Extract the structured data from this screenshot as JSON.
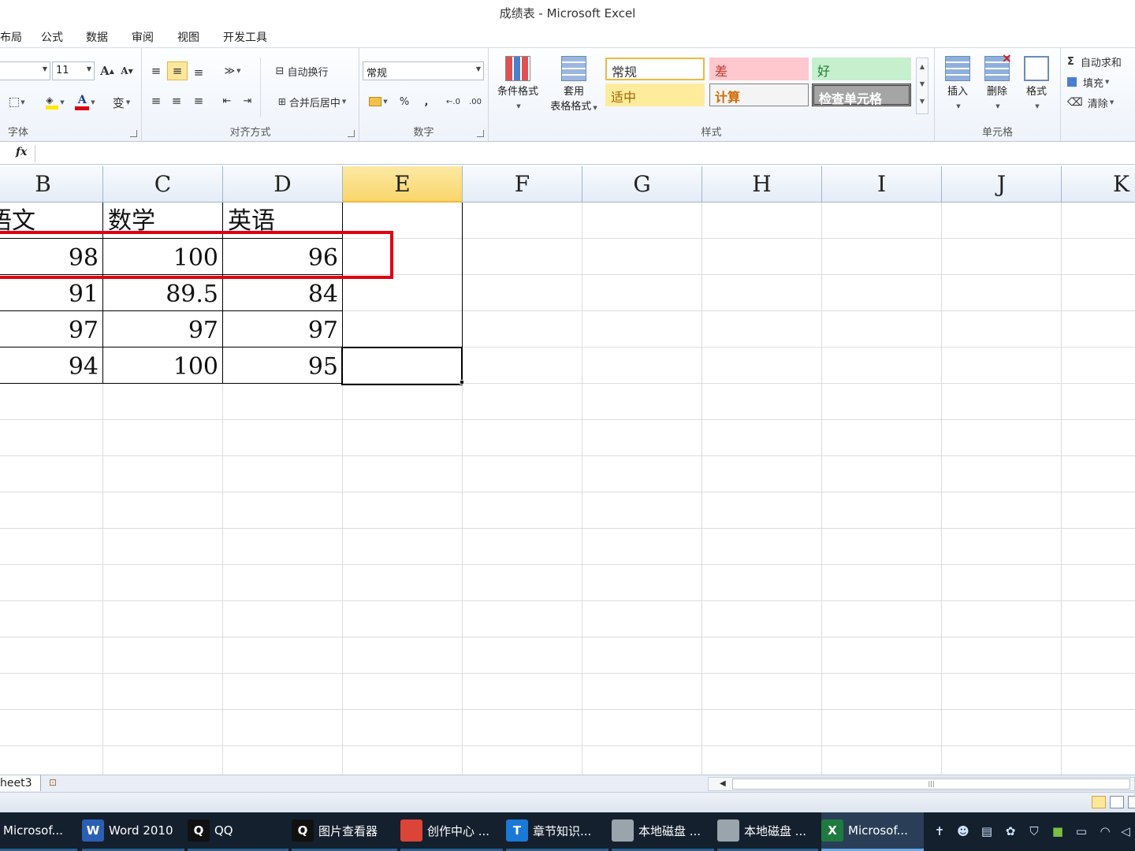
{
  "window": {
    "title": "成绩表 - Microsoft Excel"
  },
  "menu": [
    "布局",
    "公式",
    "数据",
    "审阅",
    "视图",
    "开发工具"
  ],
  "ribbon": {
    "font": {
      "size": "11",
      "label": "字体",
      "grow": "A",
      "shrink": "A",
      "font_color_letter": "A",
      "phonetic": "变"
    },
    "alignment": {
      "label": "对齐方式",
      "wrap_text": "自动换行",
      "merge_center": "合并后居中"
    },
    "number": {
      "label": "数字",
      "format": "常规",
      "percent": "%",
      "comma": ",",
      "inc_decimal": "←.0",
      "dec_decimal": ".00"
    },
    "styles": {
      "label": "样式",
      "conditional_format": "条件格式",
      "table_format_line1": "套用",
      "table_format_line2": "表格格式",
      "cells": [
        {
          "name": "常规",
          "color": "#333333",
          "bg": "#ffffff",
          "border": "#f0b93d"
        },
        {
          "name": "差",
          "color": "#c0392b",
          "bg": "#ffc7ce",
          "border": "#ffc7ce"
        },
        {
          "name": "好",
          "color": "#1e7b34",
          "bg": "#c6efce",
          "border": "#c6efce"
        },
        {
          "name": "适中",
          "color": "#9c6500",
          "bg": "#ffeb9c",
          "border": "#ffeb9c"
        },
        {
          "name": "计算",
          "color": "#d06a00",
          "bg": "#f4f4f4",
          "border": "#7f7f7f"
        },
        {
          "name": "检查单元格",
          "color": "#ffffff",
          "bg": "#a5a5a5",
          "border": "#3f3f3f"
        }
      ]
    },
    "cells": {
      "label": "单元格",
      "insert": "插入",
      "delete": "删除",
      "format": "格式"
    },
    "editing": {
      "autosum": "自动求和",
      "fill": "填充",
      "clear": "清除",
      "sigma": "Σ"
    }
  },
  "formula_bar": {
    "fx": "fx",
    "value": ""
  },
  "sheet": {
    "columns": [
      "B",
      "C",
      "D",
      "E",
      "F",
      "G",
      "H",
      "I",
      "J",
      "K"
    ],
    "selected_column": "E",
    "header_row": [
      "语文",
      "数学",
      "英语"
    ],
    "rows": [
      [
        "98",
        "100",
        "96"
      ],
      [
        "91",
        "89.5",
        "84"
      ],
      [
        "97",
        "97",
        "97"
      ],
      [
        "94",
        "100",
        "95"
      ]
    ]
  },
  "sheet_tabs": {
    "tab": "heet3"
  },
  "taskbar": {
    "items": [
      {
        "label": "Microsof...",
        "icon": "",
        "color": "#1e6fb8"
      },
      {
        "label": "Word 2010",
        "icon": "W",
        "color": "#2b5fb4"
      },
      {
        "label": "QQ",
        "icon": "Q",
        "color": "#111111"
      },
      {
        "label": "图片查看器",
        "icon": "Q",
        "color": "#111111"
      },
      {
        "label": "创作中心 ...",
        "icon": "",
        "color": "#db4437"
      },
      {
        "label": "章节知识...",
        "icon": "T",
        "color": "#1a78d6"
      },
      {
        "label": "本地磁盘 ...",
        "icon": "",
        "color": "#9aa4ad"
      },
      {
        "label": "本地磁盘 ...",
        "icon": "",
        "color": "#9aa4ad"
      },
      {
        "label": "Microsof...",
        "icon": "X",
        "color": "#1f7a3f"
      }
    ]
  }
}
